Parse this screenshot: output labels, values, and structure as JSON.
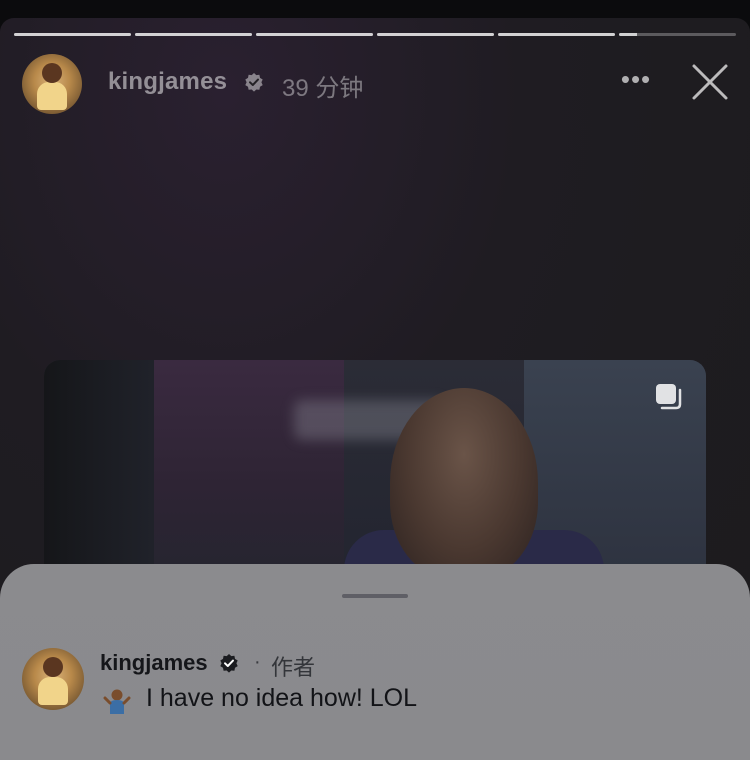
{
  "story": {
    "progress": [
      1,
      1,
      1,
      1,
      1,
      0.15
    ],
    "username": "kingjames",
    "time": "39 分钟",
    "more_label": "•••",
    "close_icon": "close-icon"
  },
  "comment": {
    "username": "kingjames",
    "separator": "·",
    "author_tag": "作者",
    "emoji_icon": "person-shrugging-emoji",
    "text": "I have no idea how! LOL"
  },
  "colors": {
    "verified_badge": "#9a9aa0",
    "sheet_bg": "#8b8b8e"
  }
}
